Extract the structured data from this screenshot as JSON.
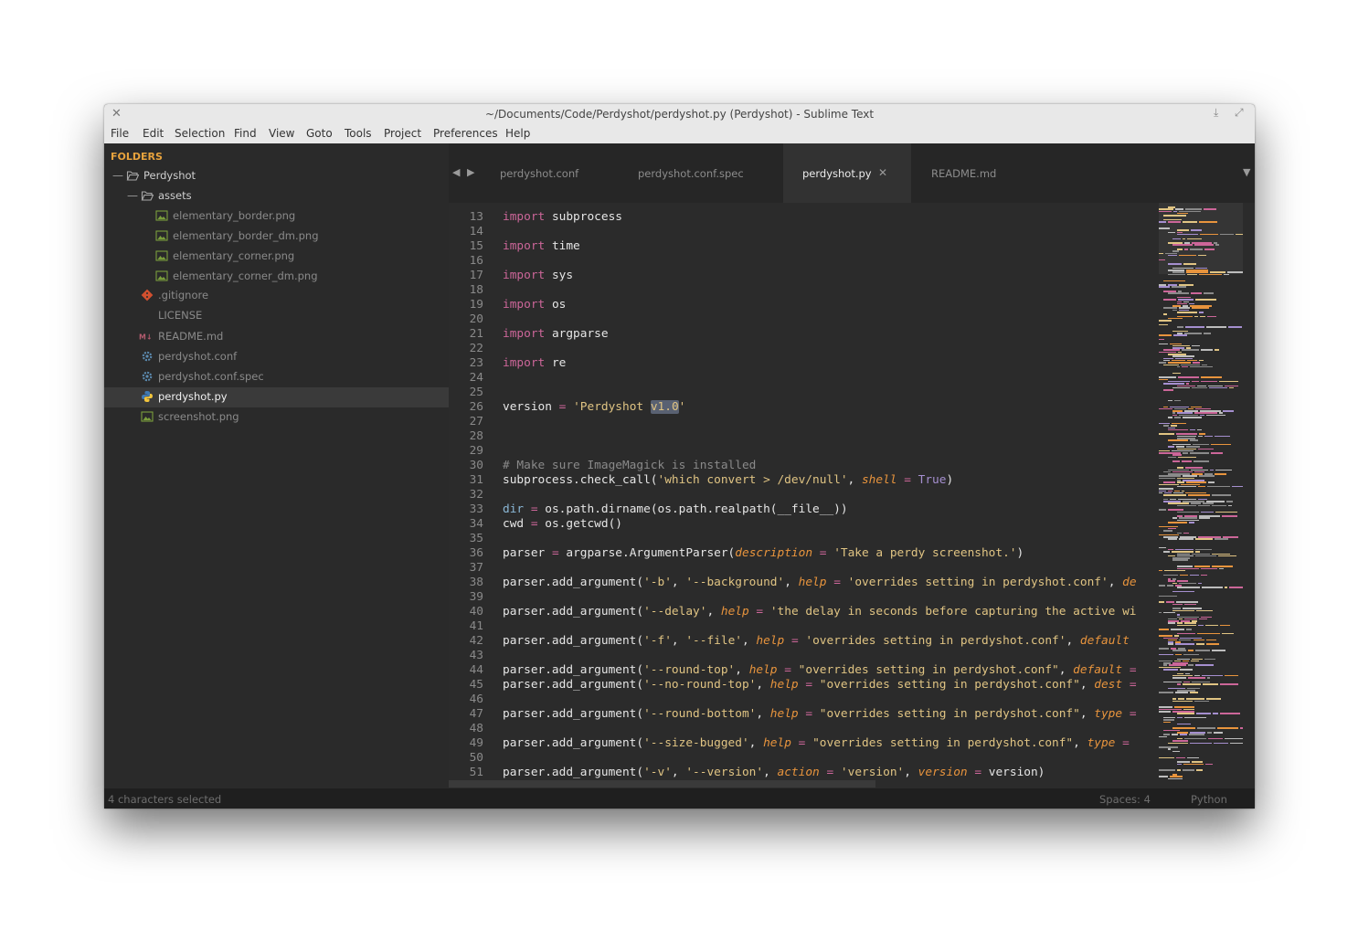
{
  "window": {
    "title": "~/Documents/Code/Perdyshot/perdyshot.py (Perdyshot) - Sublime Text",
    "close_glyph": "✕",
    "download_glyph": "⤓",
    "maximize_glyph": "⤢"
  },
  "menu": [
    "File",
    "Edit",
    "Selection",
    "Find",
    "View",
    "Goto",
    "Tools",
    "Project",
    "Preferences",
    "Help"
  ],
  "sidebar": {
    "header": "FOLDERS",
    "items": [
      {
        "label": "Perdyshot",
        "type": "folder",
        "dash": "—"
      },
      {
        "label": "assets",
        "type": "folder",
        "dash": "—"
      },
      {
        "label": "elementary_border.png",
        "type": "image"
      },
      {
        "label": "elementary_border_dm.png",
        "type": "image"
      },
      {
        "label": "elementary_corner.png",
        "type": "image"
      },
      {
        "label": "elementary_corner_dm.png",
        "type": "image"
      },
      {
        "label": ".gitignore",
        "type": "git"
      },
      {
        "label": "LICENSE",
        "type": "plain"
      },
      {
        "label": "README.md",
        "type": "markdown"
      },
      {
        "label": "perdyshot.conf",
        "type": "config"
      },
      {
        "label": "perdyshot.conf.spec",
        "type": "config"
      },
      {
        "label": "perdyshot.py",
        "type": "python",
        "selected": true
      },
      {
        "label": "screenshot.png",
        "type": "image"
      }
    ]
  },
  "tabs": {
    "left_arrow": "◀",
    "right_arrow": "▶",
    "dropdown": "▼",
    "items": [
      {
        "label": "perdyshot.conf",
        "active": false
      },
      {
        "label": "perdyshot.conf.spec",
        "active": false
      },
      {
        "label": "perdyshot.py",
        "active": true,
        "close": "✕"
      },
      {
        "label": "README.md",
        "active": false
      }
    ]
  },
  "colors": {
    "keyword": "#cc6699",
    "string": "#e0c483",
    "comment": "#8a8a8a",
    "argname": "#e8943d",
    "operator": "#cc6699",
    "constant": "#a58fcf",
    "builtin": "#8ab7d6",
    "folders_header": "#e8a33d",
    "selection": "#596172"
  },
  "editor": {
    "lines": [
      {
        "n": "13",
        "t": [
          [
            "import",
            "keyword"
          ],
          [
            " subprocess",
            ""
          ]
        ]
      },
      {
        "n": "14",
        "t": []
      },
      {
        "n": "15",
        "t": [
          [
            "import",
            "keyword"
          ],
          [
            " time",
            ""
          ]
        ]
      },
      {
        "n": "16",
        "t": []
      },
      {
        "n": "17",
        "t": [
          [
            "import",
            "keyword"
          ],
          [
            " sys",
            ""
          ]
        ]
      },
      {
        "n": "18",
        "t": []
      },
      {
        "n": "19",
        "t": [
          [
            "import",
            "keyword"
          ],
          [
            " os",
            ""
          ]
        ]
      },
      {
        "n": "20",
        "t": []
      },
      {
        "n": "21",
        "t": [
          [
            "import",
            "keyword"
          ],
          [
            " argparse",
            ""
          ]
        ]
      },
      {
        "n": "22",
        "t": []
      },
      {
        "n": "23",
        "t": [
          [
            "import",
            "keyword"
          ],
          [
            " re",
            ""
          ]
        ]
      },
      {
        "n": "24",
        "t": []
      },
      {
        "n": "25",
        "t": []
      },
      {
        "n": "26",
        "t": [
          [
            "version ",
            ""
          ],
          [
            "=",
            "operator"
          ],
          [
            " ",
            ""
          ],
          [
            "'Perdyshot ",
            "string"
          ],
          [
            "v1.0",
            "string sel"
          ],
          [
            "'",
            "string"
          ]
        ]
      },
      {
        "n": "27",
        "t": []
      },
      {
        "n": "28",
        "t": []
      },
      {
        "n": "29",
        "t": []
      },
      {
        "n": "30",
        "t": [
          [
            "# Make sure ImageMagick is installed",
            "comment"
          ]
        ]
      },
      {
        "n": "31",
        "t": [
          [
            "subprocess.check_call(",
            ""
          ],
          [
            "'which convert > /dev/null'",
            "string"
          ],
          [
            ", ",
            ""
          ],
          [
            "shell",
            "argname"
          ],
          [
            " ",
            ""
          ],
          [
            "=",
            "operator"
          ],
          [
            " ",
            ""
          ],
          [
            "True",
            "constant"
          ],
          [
            ")",
            ""
          ]
        ]
      },
      {
        "n": "32",
        "t": []
      },
      {
        "n": "33",
        "t": [
          [
            "dir",
            "builtin"
          ],
          [
            " ",
            ""
          ],
          [
            "=",
            "operator"
          ],
          [
            " os.path.dirname(os.path.realpath(__file__))",
            ""
          ]
        ]
      },
      {
        "n": "34",
        "t": [
          [
            "cwd ",
            ""
          ],
          [
            "=",
            "operator"
          ],
          [
            " os.getcwd()",
            ""
          ]
        ]
      },
      {
        "n": "35",
        "t": []
      },
      {
        "n": "36",
        "t": [
          [
            "parser ",
            ""
          ],
          [
            "=",
            "operator"
          ],
          [
            " argparse.ArgumentParser(",
            ""
          ],
          [
            "description",
            "argname"
          ],
          [
            " ",
            ""
          ],
          [
            "=",
            "operator"
          ],
          [
            " ",
            ""
          ],
          [
            "'Take a perdy screenshot.'",
            "string"
          ],
          [
            ")",
            ""
          ]
        ]
      },
      {
        "n": "37",
        "t": []
      },
      {
        "n": "38",
        "t": [
          [
            "parser.add_argument(",
            ""
          ],
          [
            "'-b'",
            "string"
          ],
          [
            ", ",
            ""
          ],
          [
            "'--background'",
            "string"
          ],
          [
            ", ",
            ""
          ],
          [
            "help",
            "argname"
          ],
          [
            " ",
            ""
          ],
          [
            "=",
            "operator"
          ],
          [
            " ",
            ""
          ],
          [
            "'overrides setting in perdyshot.conf'",
            "string"
          ],
          [
            ", ",
            ""
          ],
          [
            "de",
            "argname"
          ]
        ]
      },
      {
        "n": "39",
        "t": []
      },
      {
        "n": "40",
        "t": [
          [
            "parser.add_argument(",
            ""
          ],
          [
            "'--delay'",
            "string"
          ],
          [
            ", ",
            ""
          ],
          [
            "help",
            "argname"
          ],
          [
            " ",
            ""
          ],
          [
            "=",
            "operator"
          ],
          [
            " ",
            ""
          ],
          [
            "'the delay in seconds before capturing the active wi",
            "string"
          ]
        ]
      },
      {
        "n": "41",
        "t": []
      },
      {
        "n": "42",
        "t": [
          [
            "parser.add_argument(",
            ""
          ],
          [
            "'-f'",
            "string"
          ],
          [
            ", ",
            ""
          ],
          [
            "'--file'",
            "string"
          ],
          [
            ", ",
            ""
          ],
          [
            "help",
            "argname"
          ],
          [
            " ",
            ""
          ],
          [
            "=",
            "operator"
          ],
          [
            " ",
            ""
          ],
          [
            "'overrides setting in perdyshot.conf'",
            "string"
          ],
          [
            ", ",
            ""
          ],
          [
            "default",
            "argname"
          ]
        ]
      },
      {
        "n": "43",
        "t": []
      },
      {
        "n": "44",
        "t": [
          [
            "parser.add_argument(",
            ""
          ],
          [
            "'--round-top'",
            "string"
          ],
          [
            ", ",
            ""
          ],
          [
            "help",
            "argname"
          ],
          [
            " ",
            ""
          ],
          [
            "=",
            "operator"
          ],
          [
            " ",
            ""
          ],
          [
            "\"overrides setting in perdyshot.conf\"",
            "string"
          ],
          [
            ", ",
            ""
          ],
          [
            "default",
            "argname"
          ],
          [
            " ",
            ""
          ],
          [
            "=",
            "operator"
          ]
        ]
      },
      {
        "n": "45",
        "t": [
          [
            "parser.add_argument(",
            ""
          ],
          [
            "'--no-round-top'",
            "string"
          ],
          [
            ", ",
            ""
          ],
          [
            "help",
            "argname"
          ],
          [
            " ",
            ""
          ],
          [
            "=",
            "operator"
          ],
          [
            " ",
            ""
          ],
          [
            "\"overrides setting in perdyshot.conf\"",
            "string"
          ],
          [
            ", ",
            ""
          ],
          [
            "dest",
            "argname"
          ],
          [
            " ",
            ""
          ],
          [
            "=",
            "operator"
          ]
        ]
      },
      {
        "n": "46",
        "t": []
      },
      {
        "n": "47",
        "t": [
          [
            "parser.add_argument(",
            ""
          ],
          [
            "'--round-bottom'",
            "string"
          ],
          [
            ", ",
            ""
          ],
          [
            "help",
            "argname"
          ],
          [
            " ",
            ""
          ],
          [
            "=",
            "operator"
          ],
          [
            " ",
            ""
          ],
          [
            "\"overrides setting in perdyshot.conf\"",
            "string"
          ],
          [
            ", ",
            ""
          ],
          [
            "type",
            "argname"
          ],
          [
            " ",
            ""
          ],
          [
            "=",
            "operator"
          ]
        ]
      },
      {
        "n": "48",
        "t": []
      },
      {
        "n": "49",
        "t": [
          [
            "parser.add_argument(",
            ""
          ],
          [
            "'--size-bugged'",
            "string"
          ],
          [
            ", ",
            ""
          ],
          [
            "help",
            "argname"
          ],
          [
            " ",
            ""
          ],
          [
            "=",
            "operator"
          ],
          [
            " ",
            ""
          ],
          [
            "\"overrides setting in perdyshot.conf\"",
            "string"
          ],
          [
            ", ",
            ""
          ],
          [
            "type",
            "argname"
          ],
          [
            " ",
            ""
          ],
          [
            "=",
            "operator"
          ]
        ]
      },
      {
        "n": "50",
        "t": []
      },
      {
        "n": "51",
        "t": [
          [
            "parser.add_argument(",
            ""
          ],
          [
            "'-v'",
            "string"
          ],
          [
            ", ",
            ""
          ],
          [
            "'--version'",
            "string"
          ],
          [
            ", ",
            ""
          ],
          [
            "action",
            "argname"
          ],
          [
            " ",
            ""
          ],
          [
            "=",
            "operator"
          ],
          [
            " ",
            ""
          ],
          [
            "'version'",
            "string"
          ],
          [
            ", ",
            ""
          ],
          [
            "version",
            "argname"
          ],
          [
            " ",
            ""
          ],
          [
            "=",
            "operator"
          ],
          [
            " version)",
            ""
          ]
        ]
      }
    ]
  },
  "status": {
    "left": "4 characters selected",
    "spaces": "Spaces: 4",
    "syntax": "Python"
  }
}
